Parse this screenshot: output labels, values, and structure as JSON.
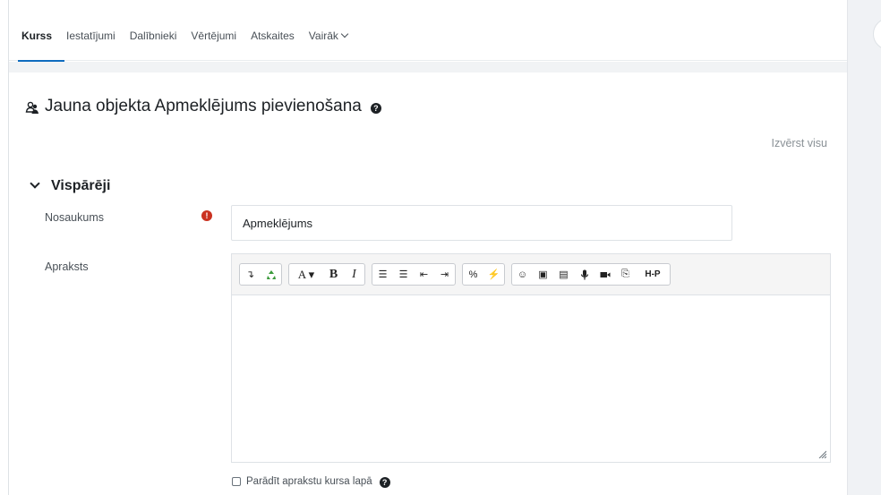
{
  "nav": {
    "tabs": [
      {
        "label": "Kurss",
        "active": true
      },
      {
        "label": "Iestatījumi"
      },
      {
        "label": "Dalībnieki"
      },
      {
        "label": "Vērtējumi"
      },
      {
        "label": "Atskaites"
      },
      {
        "label": "Vairāk"
      }
    ]
  },
  "page": {
    "title": "Jauna objekta Apmeklējums pievienošana",
    "help_glyph": "?",
    "expand_all": "Izvērst visu"
  },
  "section": {
    "title": "Vispārēji"
  },
  "form": {
    "name_label": "Nosaukums",
    "required_glyph": "!",
    "name_value": "Apmeklējums",
    "description_label": "Apraksts",
    "show_description_label": "Parādīt aprakstu kursa lapā"
  },
  "editor": {
    "toolbar_groups": [
      [
        {
          "icon": "collapse-icon",
          "glyph": "↴"
        },
        {
          "icon": "recycle-icon",
          "glyph": "♻"
        }
      ],
      [
        {
          "icon": "font-style-icon",
          "glyph": "A ▾"
        },
        {
          "icon": "bold-icon",
          "glyph": "B"
        },
        {
          "icon": "italic-icon",
          "glyph": "I"
        }
      ],
      [
        {
          "icon": "unordered-list-icon",
          "glyph": "☰"
        },
        {
          "icon": "ordered-list-icon",
          "glyph": "☰"
        },
        {
          "icon": "outdent-icon",
          "glyph": "⇤"
        },
        {
          "icon": "indent-icon",
          "glyph": "⇥"
        }
      ],
      [
        {
          "icon": "link-icon",
          "glyph": "%"
        },
        {
          "icon": "unlink-icon",
          "glyph": "⚡"
        }
      ],
      [
        {
          "icon": "emoji-icon",
          "glyph": "☺"
        },
        {
          "icon": "image-icon",
          "glyph": "▣"
        },
        {
          "icon": "media-icon",
          "glyph": "▤"
        },
        {
          "icon": "record-audio-icon",
          "glyph": "🎤"
        },
        {
          "icon": "record-video-icon",
          "glyph": "■"
        },
        {
          "icon": "manage-files-icon",
          "glyph": "⎘"
        },
        {
          "icon": "h5p-icon",
          "glyph": "H-P"
        }
      ]
    ]
  },
  "colors": {
    "accent": "#0f6cbf",
    "required": "#ca3120",
    "text": "#1d2125"
  }
}
